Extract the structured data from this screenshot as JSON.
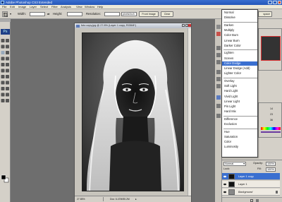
{
  "app": {
    "title": "Adobe Photoshop CS3 Extended"
  },
  "menubar": {
    "items": [
      "File",
      "Edit",
      "Image",
      "Layer",
      "Select",
      "Filter",
      "Analysis",
      "View",
      "Window",
      "Help"
    ]
  },
  "options": {
    "width_label": "Width:",
    "height_label": "Height:",
    "resolution_label": "Resolution:",
    "resolution_unit": "pixels/inch",
    "front_image_label": "Front Image",
    "clear_label": "Clear",
    "workspace_suffix": "space"
  },
  "document": {
    "title": "foto copy.jpg @ 27.8% (Layer 1 copy, RGB/8*)",
    "zoom": "27.85%",
    "doc_info": "Doc: 6.47M/55.2M"
  },
  "blend_modes": {
    "items": [
      "Normal",
      "Dissolve",
      "Darken",
      "Multiply",
      "Color Burn",
      "Linear Burn",
      "Darker Color",
      "Lighten",
      "Screen",
      "Color Dodge",
      "Linear Dodge (Add)",
      "Lighter Color",
      "Overlay",
      "Soft Light",
      "Hard Light",
      "Vivid Light",
      "Linear Light",
      "Pin Light",
      "Hard Mix",
      "Difference",
      "Exclusion",
      "Hue",
      "Saturation",
      "Color",
      "Luminosity"
    ],
    "selected": "Color Dodge",
    "current": "Normal"
  },
  "color_panel": {
    "r": "14",
    "g": "23",
    "b": "36"
  },
  "layers": {
    "opacity_label": "Opacity:",
    "opacity_value": "100%",
    "fill_label": "Fill:",
    "fill_value": "100%",
    "lock_label": "Lock:",
    "items": [
      {
        "name": "Layer 1 copy",
        "active": true
      },
      {
        "name": "Layer 1",
        "active": false
      },
      {
        "name": "Background",
        "active": false
      }
    ]
  },
  "toolbox": {
    "logo": "Ps"
  }
}
